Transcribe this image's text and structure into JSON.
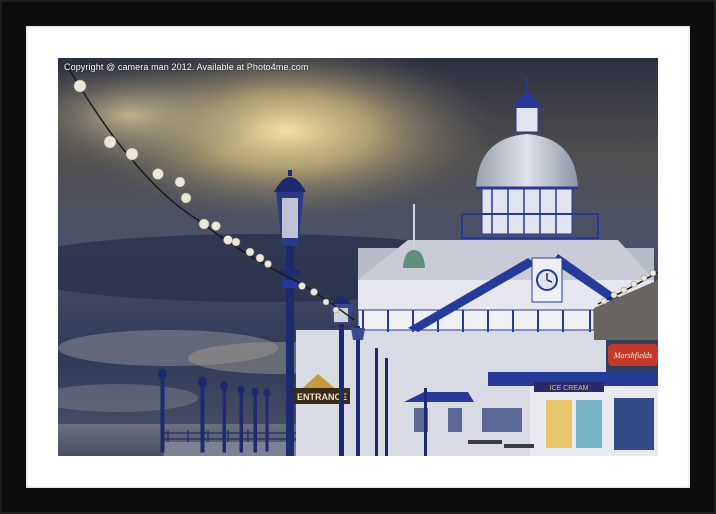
{
  "watermark": {
    "copyright_text": "Copyright @ camera man 2012. Available at Photo4me.com"
  },
  "signs": {
    "entrance": "ENTRANCE",
    "shop_logo": "Marshfields",
    "banner": "ICE CREAM"
  },
  "colors": {
    "frame": "#0d0d0d",
    "mount": "#ffffff",
    "sky_dark": "#2b3042",
    "sky_light": "#e8d29a",
    "pier_white": "#e6e7ee",
    "pier_blue": "#263a9a",
    "lamp_navy": "#1d2b6e",
    "sea": "#5b6270"
  }
}
